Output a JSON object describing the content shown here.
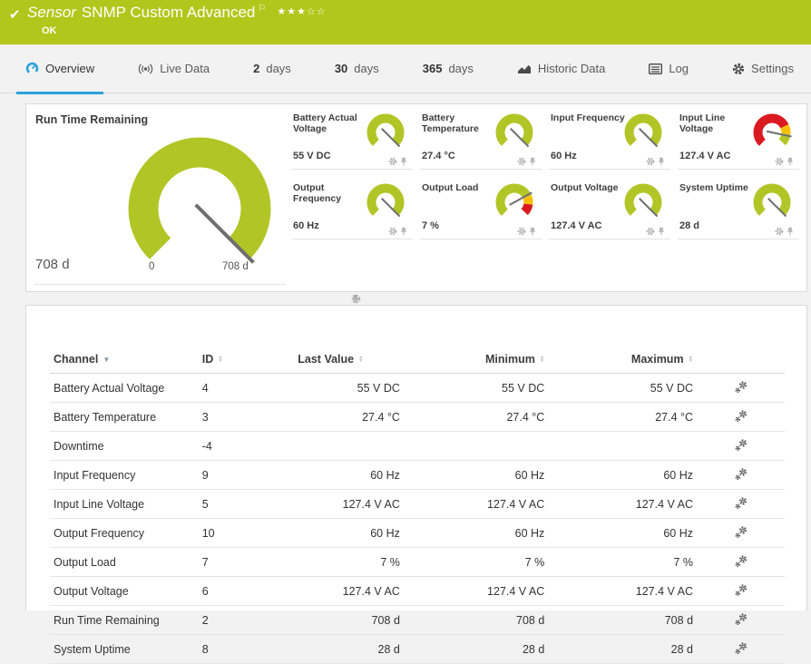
{
  "header": {
    "status_icon": "✔",
    "title_prefix": "Sensor",
    "title": "SNMP Custom Advanced",
    "flag_icon": "⚐",
    "stars": "★★★☆☆",
    "status": "OK"
  },
  "tabs": [
    {
      "label": "Overview",
      "active": true
    },
    {
      "label": "Live Data"
    },
    {
      "num": "2",
      "label": "days"
    },
    {
      "num": "30",
      "label": "days"
    },
    {
      "num": "365",
      "label": "days"
    },
    {
      "label": "Historic Data"
    },
    {
      "label": "Log"
    },
    {
      "label": "Settings"
    }
  ],
  "main_gauge": {
    "title": "Run Time Remaining",
    "value": "708 d",
    "min_label": "0",
    "max_label": "708 d",
    "type": "green"
  },
  "gauges": [
    {
      "label": "Battery Actual Voltage",
      "value": "55 V DC",
      "type": "green"
    },
    {
      "label": "Battery Temperature",
      "value": "27.4 °C",
      "type": "green"
    },
    {
      "label": "Input Frequency",
      "value": "60 Hz",
      "type": "green"
    },
    {
      "label": "Input Line Voltage",
      "value": "127.4 V AC",
      "type": "warn_red"
    },
    {
      "label": "Output Frequency",
      "value": "60 Hz",
      "type": "green"
    },
    {
      "label": "Output Load",
      "value": "7 %",
      "type": "load"
    },
    {
      "label": "Output Voltage",
      "value": "127.4 V AC",
      "type": "green"
    },
    {
      "label": "System Uptime",
      "value": "28 d",
      "type": "green"
    }
  ],
  "gauge_specs": {
    "green": {
      "segments": [
        [
          "green",
          0,
          270
        ]
      ],
      "needle": 270
    },
    "warn_red": {
      "segments": [
        [
          "red",
          0,
          200
        ],
        [
          "yellow",
          200,
          232
        ],
        [
          "green",
          232,
          270
        ]
      ],
      "needle": 237
    },
    "load": {
      "segments": [
        [
          "green",
          0,
          202
        ],
        [
          "yellow",
          202,
          234
        ],
        [
          "red",
          234,
          270
        ]
      ],
      "needle": 196
    }
  },
  "table": {
    "columns": [
      "Channel",
      "ID",
      "Last Value",
      "Minimum",
      "Maximum"
    ],
    "rows": [
      [
        "Battery Actual Voltage",
        "4",
        "55 V DC",
        "55 V DC",
        "55 V DC"
      ],
      [
        "Battery Temperature",
        "3",
        "27.4 °C",
        "27.4 °C",
        "27.4 °C"
      ],
      [
        "Downtime",
        "-4",
        "",
        "",
        ""
      ],
      [
        "Input Frequency",
        "9",
        "60 Hz",
        "60 Hz",
        "60 Hz"
      ],
      [
        "Input Line Voltage",
        "5",
        "127.4 V AC",
        "127.4 V AC",
        "127.4 V AC"
      ],
      [
        "Output Frequency",
        "10",
        "60 Hz",
        "60 Hz",
        "60 Hz"
      ],
      [
        "Output Load",
        "7",
        "7 %",
        "7 %",
        "7 %"
      ],
      [
        "Output Voltage",
        "6",
        "127.4 V AC",
        "127.4 V AC",
        "127.4 V AC"
      ],
      [
        "Run Time Remaining",
        "2",
        "708 d",
        "708 d",
        "708 d"
      ],
      [
        "System Uptime",
        "8",
        "28 d",
        "28 d",
        "28 d"
      ]
    ]
  },
  "colors": {
    "header_green": "#b3c61b",
    "accent_blue": "#2ea3d8",
    "gauge_green": "#b2c526",
    "gauge_red": "#da1a21",
    "gauge_yellow": "#f7bf00"
  }
}
